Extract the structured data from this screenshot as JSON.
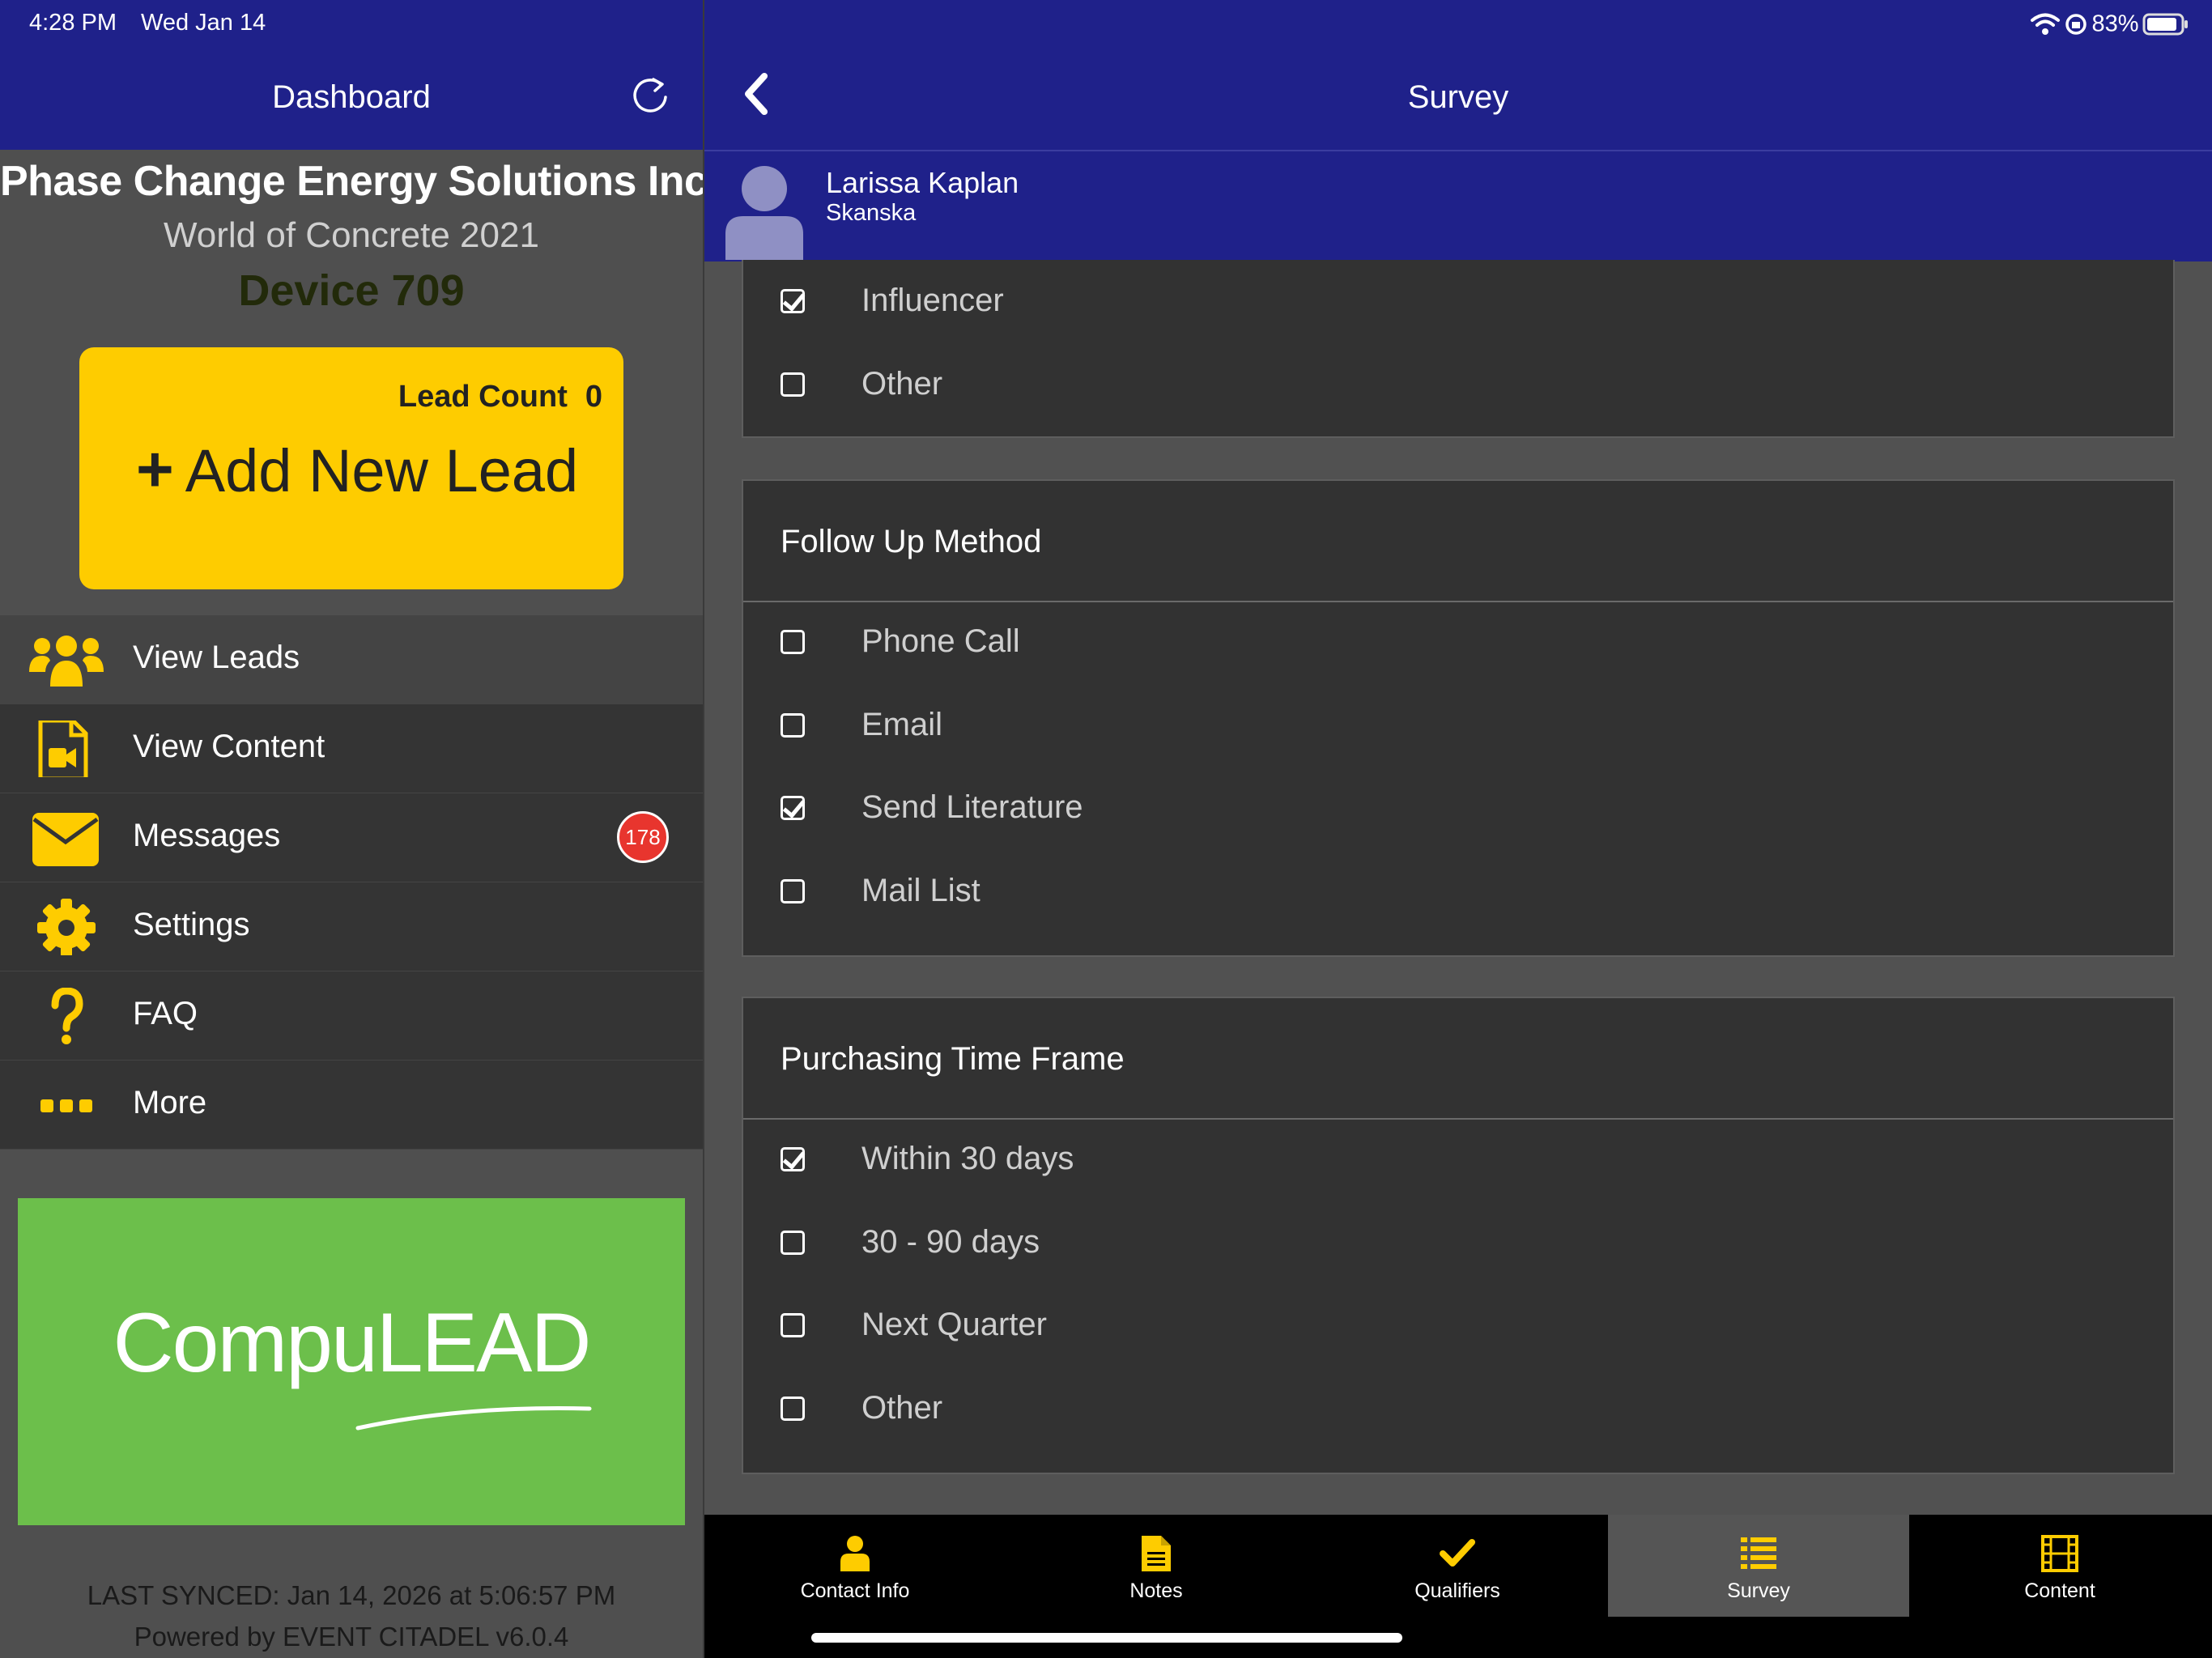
{
  "status_bar": {
    "time": "4:28 PM",
    "date": "Wed Jan 14",
    "battery": "83%"
  },
  "left": {
    "title": "Dashboard",
    "company": "Phase Change Energy Solutions Inc.",
    "event": "World of Concrete 2021",
    "device": "Device 709",
    "lead_count_label": "Lead Count",
    "lead_count": "0",
    "add_lead_label": "Add New Lead",
    "menu": [
      {
        "label": "View Leads",
        "icon": "users-icon"
      },
      {
        "label": "View Content",
        "icon": "video-file-icon"
      },
      {
        "label": "Messages",
        "icon": "envelope-icon",
        "badge": "178"
      },
      {
        "label": "Settings",
        "icon": "gear-icon"
      },
      {
        "label": "FAQ",
        "icon": "question-icon"
      },
      {
        "label": "More",
        "icon": "ellipsis-icon"
      }
    ],
    "banner_text": "CompuLEAD",
    "last_synced": "LAST SYNCED: Jan 14, 2026 at 5:06:57 PM",
    "powered_by": "Powered by EVENT CITADEL v6.0.4"
  },
  "right": {
    "title": "Survey",
    "contact": {
      "name": "Larissa Kaplan",
      "company": "Skanska"
    },
    "partial_section": {
      "options": [
        {
          "label": "Influencer",
          "checked": true
        },
        {
          "label": "Other",
          "checked": false
        }
      ]
    },
    "sections": [
      {
        "title": "Follow Up Method",
        "options": [
          {
            "label": "Phone Call",
            "checked": false
          },
          {
            "label": "Email",
            "checked": false
          },
          {
            "label": "Send Literature",
            "checked": true
          },
          {
            "label": "Mail List",
            "checked": false
          }
        ]
      },
      {
        "title": "Purchasing Time Frame",
        "options": [
          {
            "label": "Within 30 days",
            "checked": true
          },
          {
            "label": "30 - 90 days",
            "checked": false
          },
          {
            "label": "Next Quarter",
            "checked": false
          },
          {
            "label": "Other",
            "checked": false
          }
        ]
      }
    ],
    "tabs": [
      {
        "label": "Contact Info",
        "icon": "person-icon"
      },
      {
        "label": "Notes",
        "icon": "document-icon"
      },
      {
        "label": "Qualifiers",
        "icon": "checkmark-icon"
      },
      {
        "label": "Survey",
        "icon": "list-icon",
        "active": true
      },
      {
        "label": "Content",
        "icon": "film-icon"
      }
    ]
  },
  "colors": {
    "header_blue": "#1f218a",
    "accent_yellow": "#fecc00",
    "banner_green": "#6cbf4b",
    "badge_red": "#e8352e"
  }
}
